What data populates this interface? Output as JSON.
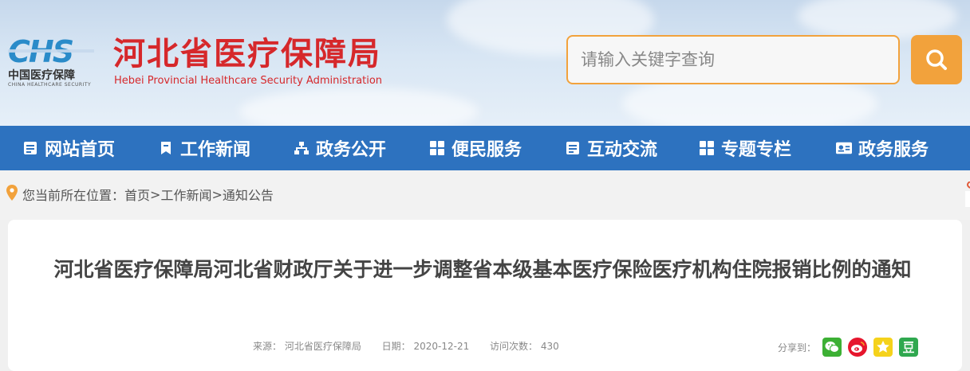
{
  "header": {
    "logo_cn": "中国医疗保障",
    "logo_en": "CHINA HEALTHCARE SECURITY",
    "site_title": "河北省医疗保障局",
    "site_title_en": "Hebei Provincial Healthcare Security Administration",
    "search_placeholder": "请输入关键字查询"
  },
  "nav": {
    "items": [
      {
        "label": "网站首页",
        "icon": "list-icon"
      },
      {
        "label": "工作新闻",
        "icon": "bookmark-icon"
      },
      {
        "label": "政务公开",
        "icon": "sitemap-icon"
      },
      {
        "label": "便民服务",
        "icon": "grid-icon"
      },
      {
        "label": "互动交流",
        "icon": "list-icon"
      },
      {
        "label": "专题专栏",
        "icon": "grid-icon"
      },
      {
        "label": "政务服务",
        "icon": "id-card-icon"
      }
    ]
  },
  "breadcrumb": {
    "prefix": "您当前所在位置：",
    "items": [
      "首页",
      "工作新闻",
      "通知公告"
    ],
    "separator": ">"
  },
  "article": {
    "title": "河北省医疗保障局河北省财政厅关于进一步调整省本级基本医疗保险医疗机构住院报销比例的通知",
    "source": "来源： 河北省医疗保障局",
    "date": "日期： 2020-12-21",
    "views": "访问次数： 430",
    "share_label": "分享到："
  },
  "colors": {
    "nav_bg": "#2d72bf",
    "brand_red": "#d6282b",
    "accent_orange": "#f2a23c",
    "logo_blue": "#2a8bc9"
  }
}
